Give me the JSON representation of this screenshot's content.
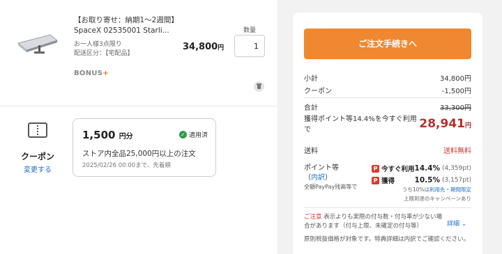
{
  "product": {
    "title": "【お取り寄せ：納期1～2週間】SpaceX 02535001 Starli...",
    "meta_line1": "お一人様3点限り",
    "meta_line2": "配送区分：【宅配品】",
    "price": "34,800",
    "price_unit": "円",
    "quantity_label": "数量",
    "quantity_value": "1",
    "bonus_text": "BONUS",
    "bonus_plus": "+"
  },
  "coupon": {
    "label": "クーポン",
    "change_link": "変更する",
    "amount": "1,500",
    "amount_unit": "円分",
    "applied_label": "適用済",
    "condition": "ストア内全品25,000円以上の注文",
    "expiry": "2025/02/26 00:00まで、先着順"
  },
  "summary": {
    "order_button": "ご注文手続きへ",
    "subtotal_label": "小計",
    "subtotal_value": "34,800円",
    "coupon_label": "クーポン",
    "coupon_value": "-1,500円",
    "total_label": "合計",
    "total_value": "33,300円",
    "earn_text": "獲得ポイント等14.4%を今すぐ利用で",
    "earn_price": "28,941",
    "earn_unit": "円",
    "shipping_label": "送料",
    "shipping_value": "送料無料",
    "points_label": "ポイント等",
    "points_breakdown_open": "（",
    "points_breakdown_link": "内訳",
    "points_breakdown_close": "）",
    "points_sub": "全額PayPay残高等で",
    "now_use_name": "今すぐ利用",
    "now_use_pct": "14.4%",
    "now_use_pts": "(4,359pt)",
    "earn_name": "獲得",
    "earn_pct": "10.5%",
    "earn_pts": "(3,157pt)",
    "note1_prefix": "うち10%は",
    "note1_link": "利用先・期間限定",
    "note2": "上限到達のキャンペーンあり",
    "caution_label": "ご注意",
    "caution_text": "表示よりも実際の付与数・付与率が少ない場合があります（付与上限、未確定の付与等）",
    "detail_link": "詳細",
    "footer_note": "原則税抜価格が対象です。特典詳細は内訳でご確認ください。",
    "badge_letter": "P"
  },
  "colors": {
    "accent_orange": "#ef8830",
    "price_red": "#b0332d",
    "link_blue": "#1e6fc6",
    "applied_green": "#2e9b4a"
  }
}
